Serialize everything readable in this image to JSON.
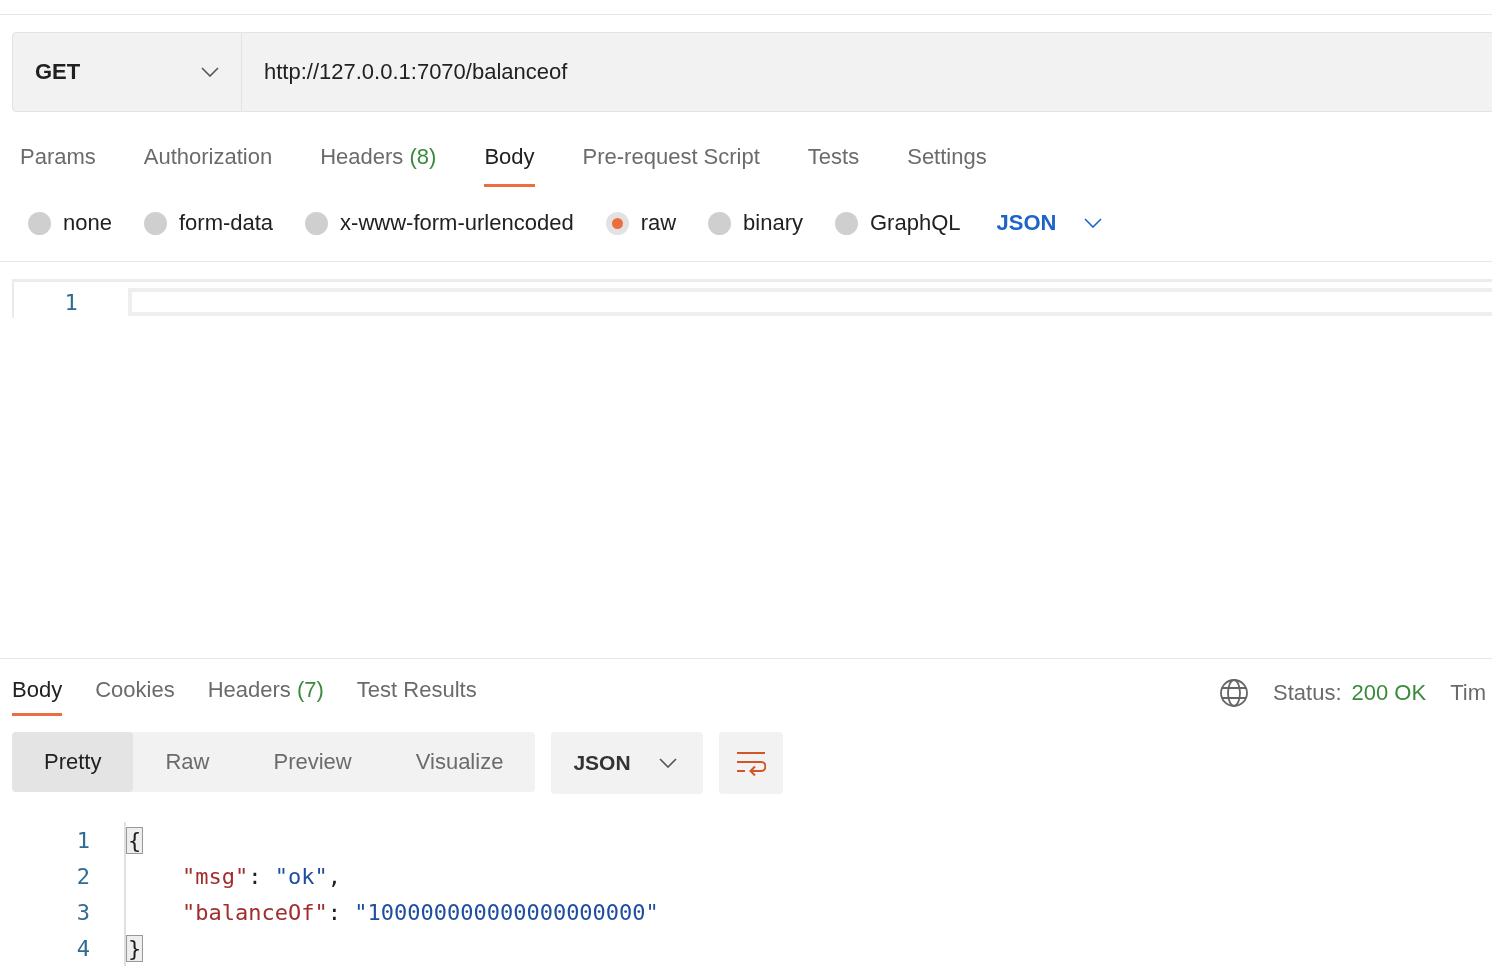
{
  "request": {
    "method": "GET",
    "url": "http://127.0.0.1:7070/balanceof"
  },
  "request_tabs": [
    {
      "label": "Params",
      "selected": false
    },
    {
      "label": "Authorization",
      "selected": false
    },
    {
      "label": "Headers",
      "count": "(8)",
      "selected": false
    },
    {
      "label": "Body",
      "selected": true
    },
    {
      "label": "Pre-request Script",
      "selected": false
    },
    {
      "label": "Tests",
      "selected": false
    },
    {
      "label": "Settings",
      "selected": false
    }
  ],
  "body_types": [
    {
      "label": "none",
      "selected": false
    },
    {
      "label": "form-data",
      "selected": false
    },
    {
      "label": "x-www-form-urlencoded",
      "selected": false
    },
    {
      "label": "raw",
      "selected": true
    },
    {
      "label": "binary",
      "selected": false
    },
    {
      "label": "GraphQL",
      "selected": false
    }
  ],
  "body_format": "JSON",
  "editor": {
    "line_numbers": [
      "1"
    ]
  },
  "response_tabs": [
    {
      "label": "Body",
      "selected": true
    },
    {
      "label": "Cookies",
      "selected": false
    },
    {
      "label": "Headers",
      "count": "(7)",
      "selected": false
    },
    {
      "label": "Test Results",
      "selected": false
    }
  ],
  "status": {
    "label": "Status:",
    "value": "200 OK"
  },
  "time_label": "Tim",
  "view_modes": [
    {
      "label": "Pretty",
      "selected": true
    },
    {
      "label": "Raw",
      "selected": false
    },
    {
      "label": "Preview",
      "selected": false
    },
    {
      "label": "Visualize",
      "selected": false
    }
  ],
  "response_format": "JSON",
  "response_lines": [
    {
      "number": "1",
      "indented": false,
      "tokens": [
        {
          "kind": "brace",
          "text": "{"
        }
      ]
    },
    {
      "number": "2",
      "indented": true,
      "tokens": [
        {
          "kind": "key",
          "text": "\"msg\""
        },
        {
          "kind": "punct",
          "text": ": "
        },
        {
          "kind": "string",
          "text": "\"ok\""
        },
        {
          "kind": "punct",
          "text": ","
        }
      ]
    },
    {
      "number": "3",
      "indented": true,
      "tokens": [
        {
          "kind": "key",
          "text": "\"balanceOf\""
        },
        {
          "kind": "punct",
          "text": ": "
        },
        {
          "kind": "string",
          "text": "\"100000000000000000000\""
        }
      ]
    },
    {
      "number": "4",
      "indented": false,
      "tokens": [
        {
          "kind": "brace",
          "text": "}"
        }
      ]
    }
  ]
}
